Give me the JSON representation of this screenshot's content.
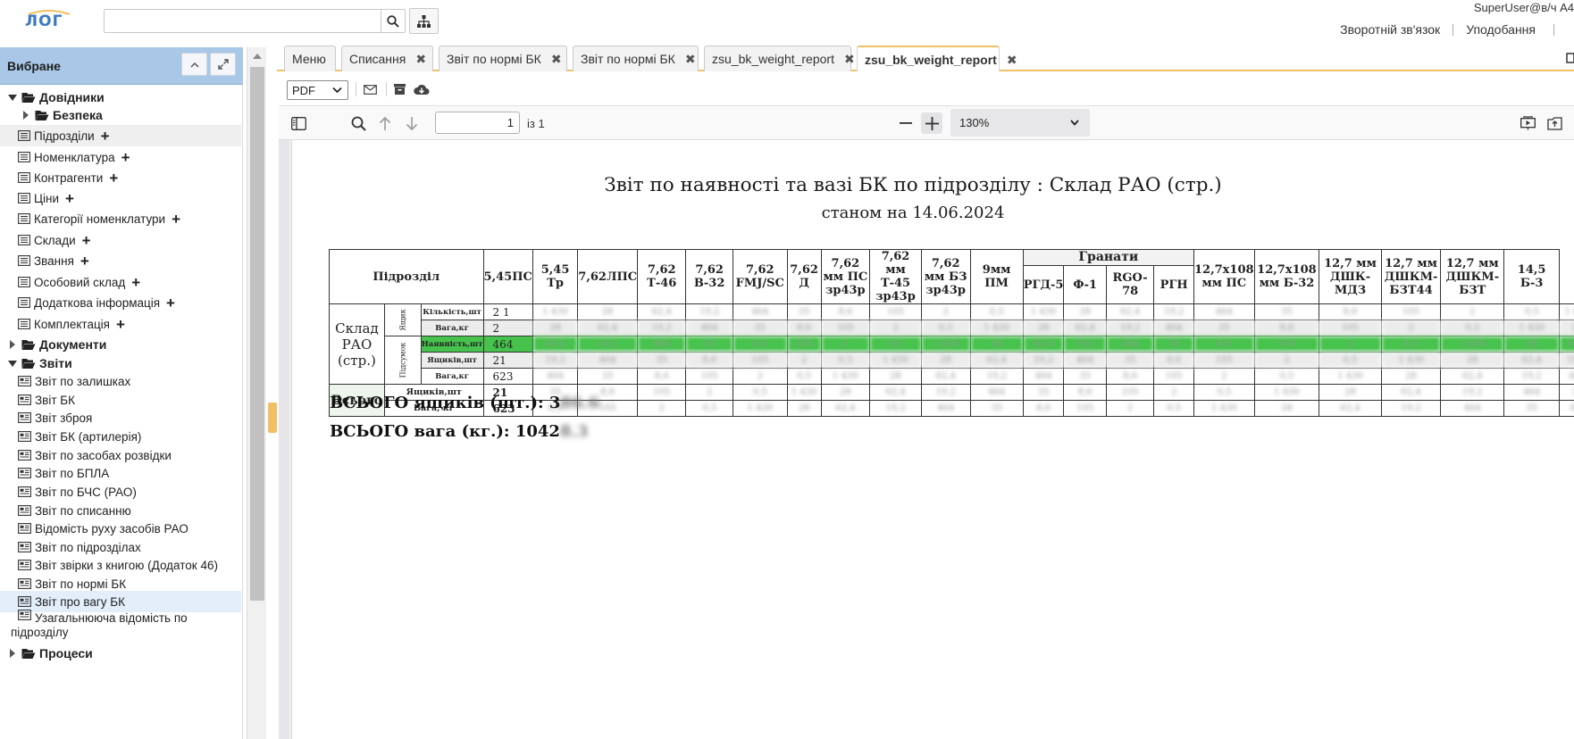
{
  "header": {
    "search_placeholder": "",
    "user": "SuperUser@в/ч А4",
    "links": [
      "Зворотній зв'язок",
      "Уподобання"
    ]
  },
  "sidebar": {
    "title": "Вибране",
    "items": [
      {
        "label": "Довідники",
        "type": "folder",
        "expanded": true
      },
      {
        "label": "Безпека",
        "type": "folder",
        "expanded": false
      },
      {
        "label": "Підрозділи",
        "type": "item"
      },
      {
        "label": "Номенклатура",
        "type": "item"
      },
      {
        "label": "Контрагенти",
        "type": "item"
      },
      {
        "label": "Ціни",
        "type": "item"
      },
      {
        "label": "Категорії номенклатури",
        "type": "item"
      },
      {
        "label": "Склади",
        "type": "item"
      },
      {
        "label": "Звання",
        "type": "item"
      },
      {
        "label": "Особовий склад",
        "type": "item"
      },
      {
        "label": "Додаткова інформація",
        "type": "item"
      },
      {
        "label": "Комплектація",
        "type": "item"
      },
      {
        "label": "Документи",
        "type": "folder",
        "expanded": false
      },
      {
        "label": "Звіти",
        "type": "folder",
        "expanded": true
      },
      {
        "label": "Звіт по залишках",
        "type": "report"
      },
      {
        "label": "Звіт БК",
        "type": "report"
      },
      {
        "label": "Звіт зброя",
        "type": "report"
      },
      {
        "label": "Звіт БК (артилерія)",
        "type": "report"
      },
      {
        "label": "Звіт по засобах розвідки",
        "type": "report"
      },
      {
        "label": "Звіт по БПЛА",
        "type": "report"
      },
      {
        "label": "Звіт по БЧС (РАО)",
        "type": "report"
      },
      {
        "label": "Звіт по списанню",
        "type": "report"
      },
      {
        "label": "Відомість руху засобів РАО",
        "type": "report"
      },
      {
        "label": "Звіт по підрозділах",
        "type": "report"
      },
      {
        "label": "Звіт звірки з книгою (Додаток 46)",
        "type": "report"
      },
      {
        "label": "Звіт по нормі БК",
        "type": "report"
      },
      {
        "label": "Звіт про вагу БК",
        "type": "report",
        "selected": true
      },
      {
        "label": "Узагальнююча відомість по",
        "label2": "підрозділу",
        "type": "report"
      },
      {
        "label": "Процеси",
        "type": "folder",
        "expanded": false
      }
    ]
  },
  "tabs": [
    {
      "label": "Меню",
      "closable": false
    },
    {
      "label": "Списання",
      "closable": true
    },
    {
      "label": "Звіт по нормі БК",
      "closable": true
    },
    {
      "label": "Звіт по нормі БК",
      "closable": true
    },
    {
      "label": "zsu_bk_weight_report",
      "closable": true
    },
    {
      "label": "zsu_bk_weight_report",
      "closable": true,
      "active": true
    }
  ],
  "toolbar": {
    "format": "PDF"
  },
  "pdf": {
    "page": "1",
    "page_of": "із 1",
    "zoom": "130%"
  },
  "report": {
    "title": "Звіт по наявності та вазі БК по підрозділу : Склад РАО (стр.)",
    "subtitle": "станом на 14.06.2024",
    "col_header_unit": "Підрозділ",
    "columns": [
      "5,45ПС",
      "5,45 Тр",
      "7,62ЛПС",
      "7,62 Т-46",
      "7,62 В-32",
      "7,62 FMJ/SC",
      "7,62 Д",
      "7,62 мм ПС зр43р",
      "7,62 мм Т-45 зр43р",
      "7,62 мм БЗ зр43р",
      "9мм ПМ"
    ],
    "group_label": "Гранати",
    "group_columns": [
      "РГД-5",
      "Ф-1",
      "RGO-78",
      "РГН"
    ],
    "columns_right": [
      "12,7х108 мм ПС",
      "12,7х108 мм Б-32",
      "12,7 мм ДШК-МДЗ",
      "12,7 мм ДШКМ-БЗТ44",
      "12,7 мм ДШКМ-БЗТ",
      "14,5 Б-3"
    ],
    "unit_name": "Склад РАО (стр.)",
    "vert_box": "Ящик",
    "vert_pack": "Підсумок",
    "rows": [
      {
        "label": "Кількість,шт",
        "value": "2 1"
      },
      {
        "label": "Вага,кг",
        "value": "2"
      },
      {
        "label": "Наявність,шт",
        "value": "464",
        "highlight": true
      },
      {
        "label": "Ящиків,шт",
        "value": "21"
      },
      {
        "label": "Вага,кг",
        "value": "623"
      }
    ],
    "total_label": "Всього",
    "total_rows": [
      {
        "label": "Ящиків,шт",
        "value": "21"
      },
      {
        "label": "Вага, кг",
        "value": "623"
      }
    ],
    "total_boxes_label": "ВСЬОГО ящиків (шт.): 3",
    "total_boxes_hidden": "86.6",
    "total_weight_label": "ВСЬОГО вага (кг.): 1042",
    "total_weight_hidden": "8.3"
  },
  "colors": {
    "accent": "#f0c064",
    "sidebar_header": "#a9c8e8",
    "highlight_row": "#46c24d"
  }
}
